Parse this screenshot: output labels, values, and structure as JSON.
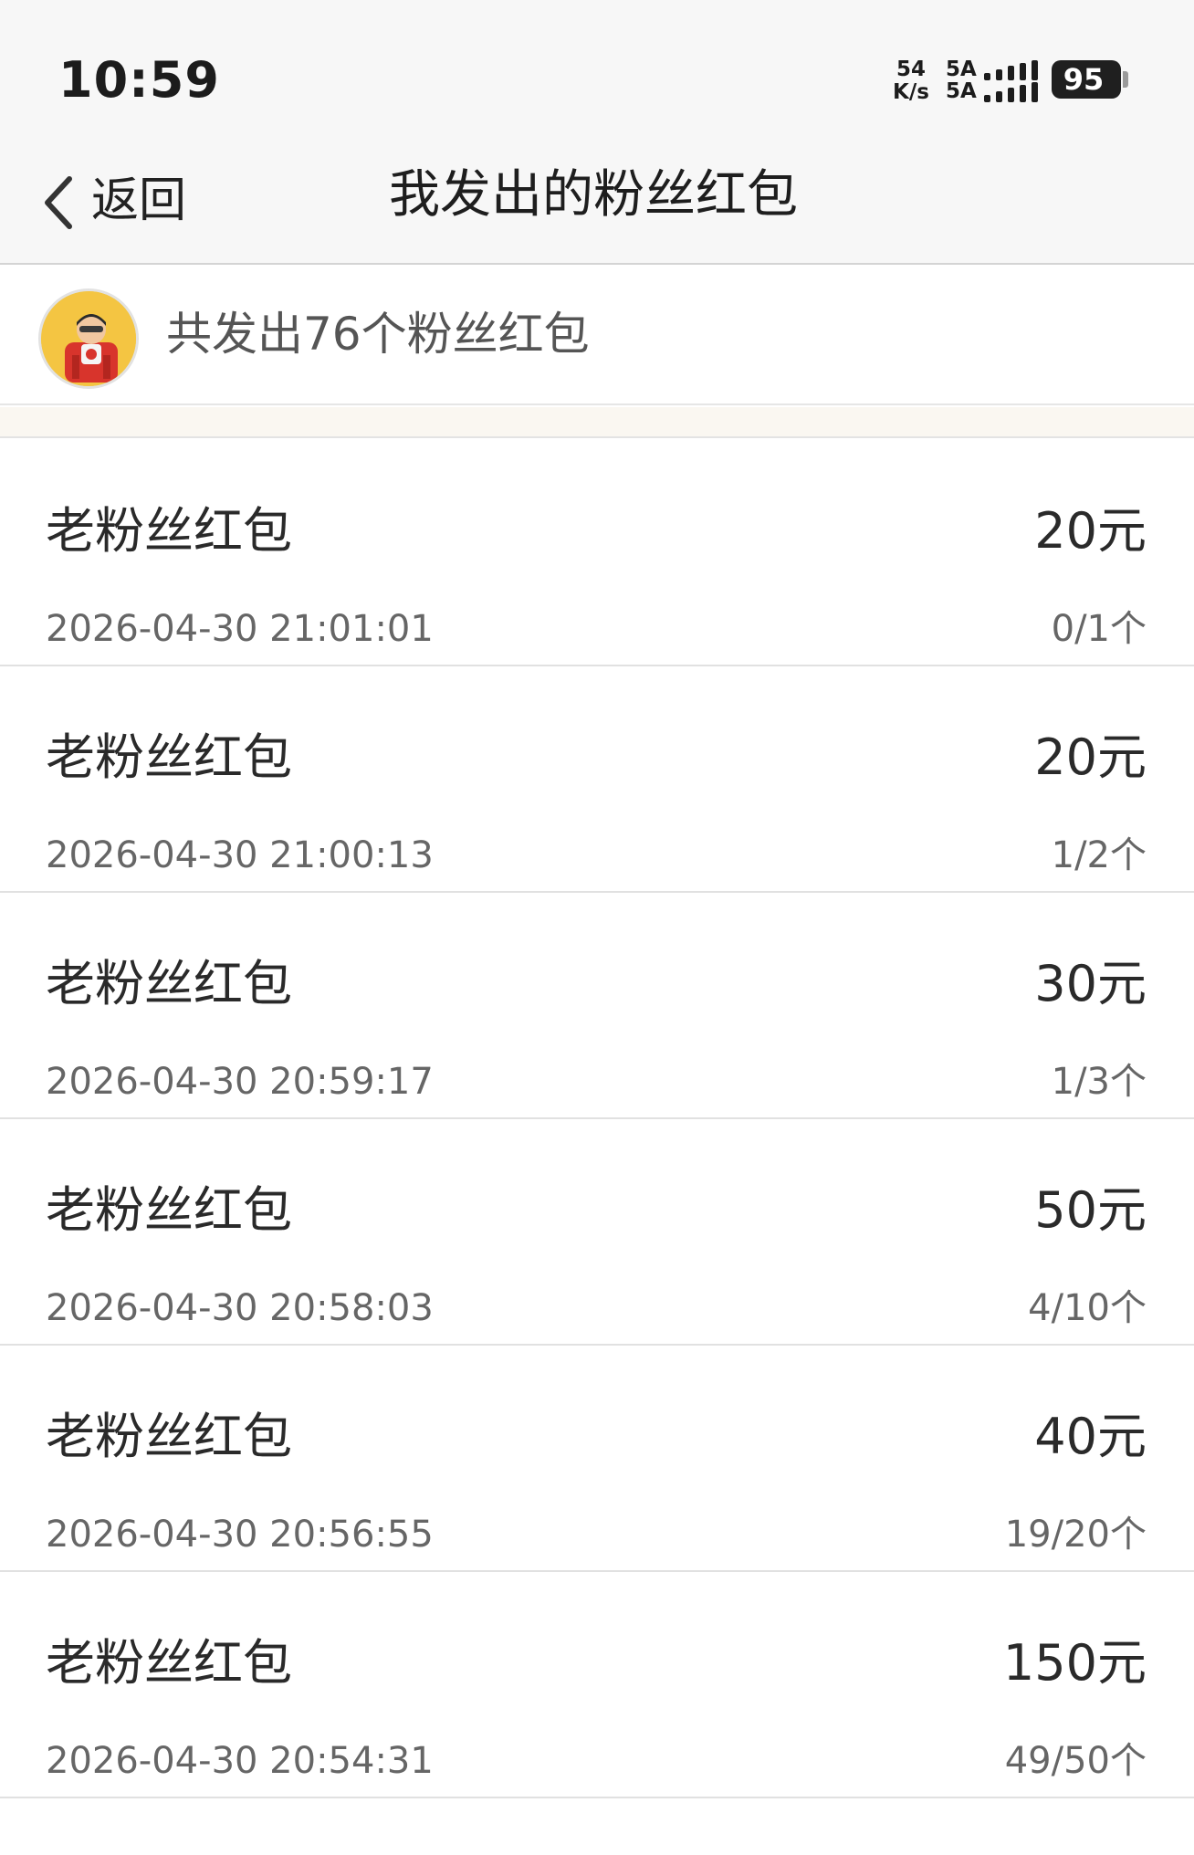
{
  "status_bar": {
    "time": "10:59",
    "net_speed_value": "54",
    "net_speed_unit": "K/s",
    "sim1_label": "5A",
    "sim2_label": "5A",
    "battery_level": "95"
  },
  "nav": {
    "back_label": "返回",
    "title": "我发出的粉丝红包"
  },
  "summary": {
    "text": "共发出76个粉丝红包"
  },
  "items": [
    {
      "title": "老粉丝红包",
      "amount": "20元",
      "time": "2026-04-30 21:01:01",
      "count": "0/1个"
    },
    {
      "title": "老粉丝红包",
      "amount": "20元",
      "time": "2026-04-30 21:00:13",
      "count": "1/2个"
    },
    {
      "title": "老粉丝红包",
      "amount": "30元",
      "time": "2026-04-30 20:59:17",
      "count": "1/3个"
    },
    {
      "title": "老粉丝红包",
      "amount": "50元",
      "time": "2026-04-30 20:58:03",
      "count": "4/10个"
    },
    {
      "title": "老粉丝红包",
      "amount": "40元",
      "time": "2026-04-30 20:56:55",
      "count": "19/20个"
    },
    {
      "title": "老粉丝红包",
      "amount": "150元",
      "time": "2026-04-30 20:54:31",
      "count": "49/50个"
    }
  ],
  "icons": {
    "back": "chevron-left-icon",
    "avatar": "cartoon-avatar-icon",
    "signal": "cellular-signal-icon",
    "battery": "battery-icon"
  },
  "colors": {
    "avatar_bg": "#f4c542",
    "header_bg": "#f7f7f7",
    "divider": "#e1e1e1"
  }
}
